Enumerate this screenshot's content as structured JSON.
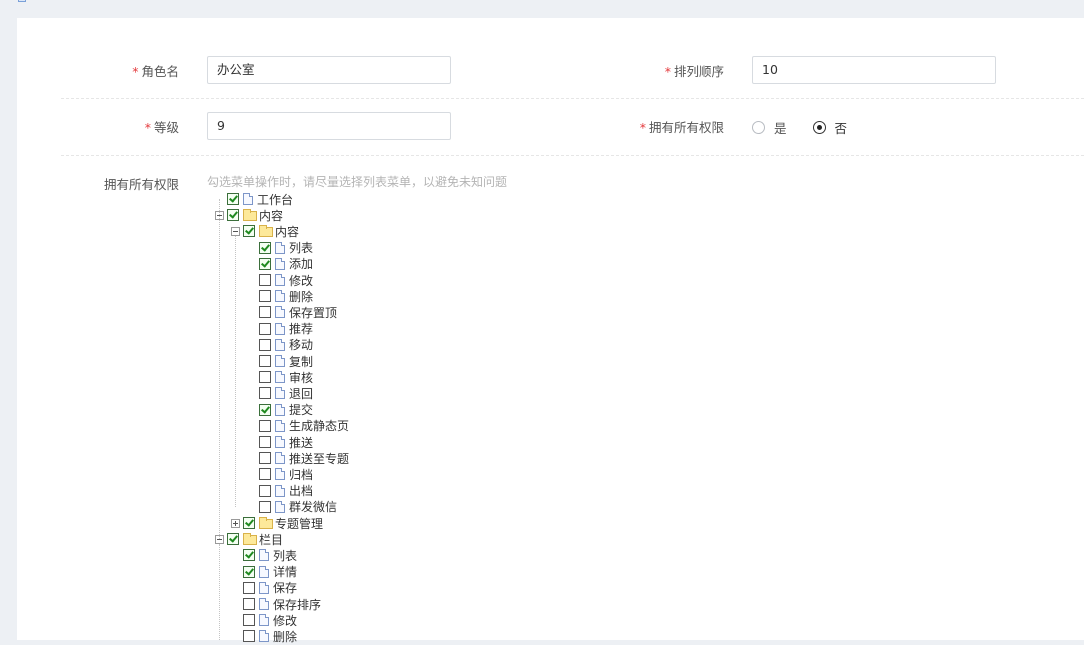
{
  "form": {
    "role_name": {
      "label": "角色名",
      "required": "*",
      "value": "办公室"
    },
    "sort_order": {
      "label": "排列顺序",
      "required": "*",
      "value": "10"
    },
    "level": {
      "label": "等级",
      "required": "*",
      "value": "9"
    },
    "all_permissions": {
      "label": "拥有所有权限",
      "required": "*",
      "options": [
        {
          "label": "是",
          "checked": false
        },
        {
          "label": "否",
          "checked": true
        }
      ]
    },
    "permissions": {
      "label": "拥有所有权限",
      "hint": "勾选菜单操作时，请尽量选择列表菜单，以避免未知问题"
    }
  },
  "tree": [
    {
      "label": "工作台",
      "level": 0,
      "type": "file",
      "checked": true,
      "expander": "none"
    },
    {
      "label": "内容",
      "level": 0,
      "type": "folder",
      "checked": true,
      "expander": "minus"
    },
    {
      "label": "内容",
      "level": 1,
      "type": "folder",
      "checked": true,
      "expander": "minus"
    },
    {
      "label": "列表",
      "level": 2,
      "type": "file",
      "checked": true,
      "expander": "none"
    },
    {
      "label": "添加",
      "level": 2,
      "type": "file",
      "checked": true,
      "expander": "none"
    },
    {
      "label": "修改",
      "level": 2,
      "type": "file",
      "checked": false,
      "expander": "none"
    },
    {
      "label": "删除",
      "level": 2,
      "type": "file",
      "checked": false,
      "expander": "none"
    },
    {
      "label": "保存置顶",
      "level": 2,
      "type": "file",
      "checked": false,
      "expander": "none"
    },
    {
      "label": "推荐",
      "level": 2,
      "type": "file",
      "checked": false,
      "expander": "none"
    },
    {
      "label": "移动",
      "level": 2,
      "type": "file",
      "checked": false,
      "expander": "none"
    },
    {
      "label": "复制",
      "level": 2,
      "type": "file",
      "checked": false,
      "expander": "none"
    },
    {
      "label": "审核",
      "level": 2,
      "type": "file",
      "checked": false,
      "expander": "none"
    },
    {
      "label": "退回",
      "level": 2,
      "type": "file",
      "checked": false,
      "expander": "none"
    },
    {
      "label": "提交",
      "level": 2,
      "type": "file",
      "checked": true,
      "expander": "none"
    },
    {
      "label": "生成静态页",
      "level": 2,
      "type": "file",
      "checked": false,
      "expander": "none"
    },
    {
      "label": "推送",
      "level": 2,
      "type": "file",
      "checked": false,
      "expander": "none"
    },
    {
      "label": "推送至专题",
      "level": 2,
      "type": "file",
      "checked": false,
      "expander": "none"
    },
    {
      "label": "归档",
      "level": 2,
      "type": "file",
      "checked": false,
      "expander": "none"
    },
    {
      "label": "出档",
      "level": 2,
      "type": "file",
      "checked": false,
      "expander": "none"
    },
    {
      "label": "群发微信",
      "level": 2,
      "type": "file",
      "checked": false,
      "expander": "none"
    },
    {
      "label": "专题管理",
      "level": 1,
      "type": "folder",
      "checked": true,
      "expander": "plus"
    },
    {
      "label": "栏目",
      "level": 0,
      "type": "folder",
      "checked": true,
      "expander": "minus"
    },
    {
      "label": "列表",
      "level": 1,
      "type": "file",
      "checked": true,
      "expander": "none"
    },
    {
      "label": "详情",
      "level": 1,
      "type": "file",
      "checked": true,
      "expander": "none"
    },
    {
      "label": "保存",
      "level": 1,
      "type": "file",
      "checked": false,
      "expander": "none"
    },
    {
      "label": "保存排序",
      "level": 1,
      "type": "file",
      "checked": false,
      "expander": "none"
    },
    {
      "label": "修改",
      "level": 1,
      "type": "file",
      "checked": false,
      "expander": "none"
    },
    {
      "label": "删除",
      "level": 1,
      "type": "file",
      "checked": false,
      "expander": "none"
    }
  ]
}
